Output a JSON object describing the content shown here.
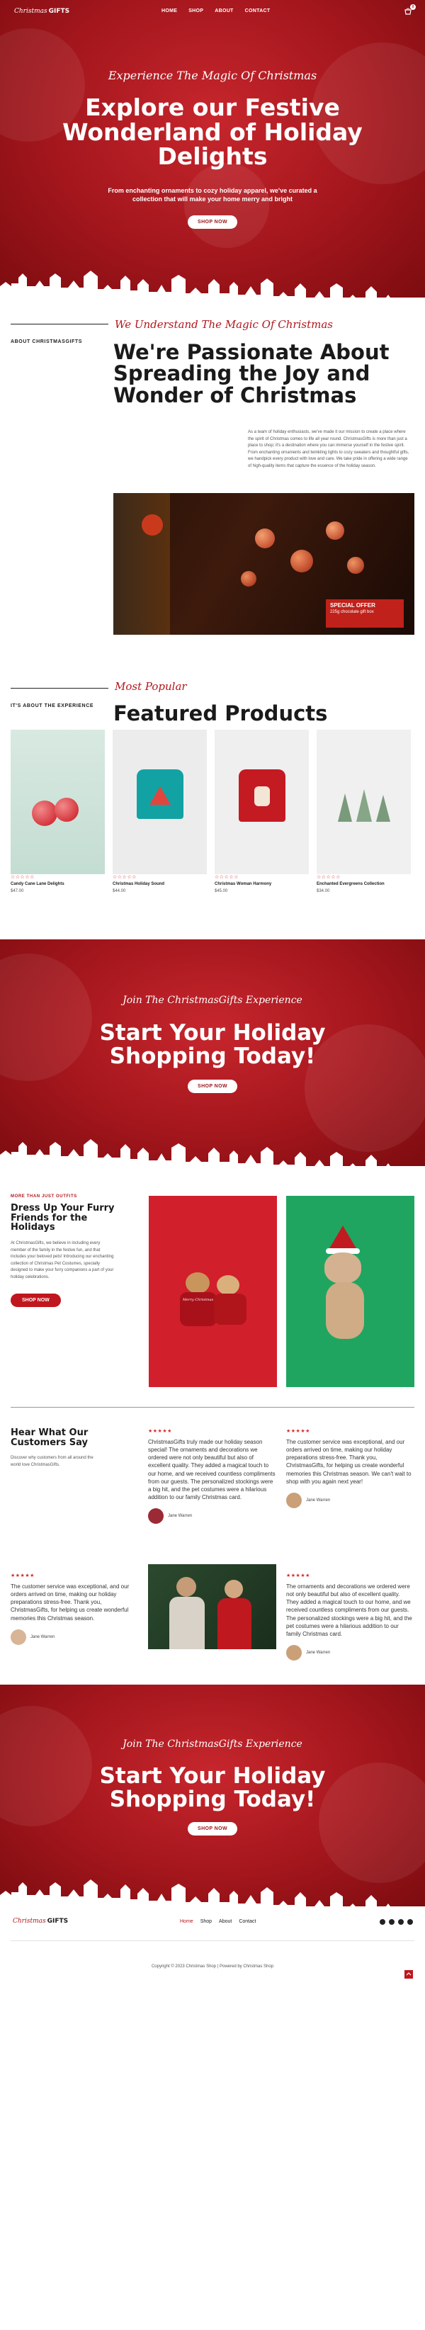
{
  "header": {
    "logo_script": "Christmas",
    "logo_bold": "GIFTS",
    "nav": [
      "HOME",
      "SHOP",
      "ABOUT",
      "CONTACT"
    ],
    "cart_count": "0"
  },
  "hero": {
    "kicker": "Experience The Magic Of Christmas",
    "title_line1": "Explore our Festive",
    "title_line2": "Wonderland of Holiday",
    "title_line3": "Delights",
    "subtitle_line1": "From enchanting ornaments to cozy holiday apparel, we've curated a",
    "subtitle_line2": "collection that will make your home merry and bright",
    "button": "SHOP NOW"
  },
  "about": {
    "label": "ABOUT CHRISTMASGIFTS",
    "kicker": "We Understand The Magic Of Christmas",
    "title_line1": "We're Passionate About",
    "title_line2": "Spreading the Joy and",
    "title_line3": "Wonder of Christmas",
    "body": "As a team of holiday enthusiasts, we've made it our mission to create a place where the spirit of Christmas comes to life all year round. ChristmasGifts is more than just a place to shop; it's a destination where you can immerse yourself in the festive spirit. From enchanting ornaments and twinkling lights to cozy sweaters and thoughtful gifts, we handpick every product with love and care. We take pride in offering a wide range of high-quality items that capture the essence of the holiday season.",
    "image_sign_1": "SPECIAL OFFER",
    "image_sign_2": "225g chocolate gift box"
  },
  "featured": {
    "label": "IT'S ABOUT THE EXPERIENCE",
    "kicker": "Most Popular",
    "title": "Featured Products",
    "products": [
      {
        "name": "Candy Cane Lane Delights",
        "price": "$47.00",
        "rating": "☆☆☆☆☆"
      },
      {
        "name": "Christmas Holiday Sound",
        "price": "$44.00",
        "rating": "☆☆☆☆☆"
      },
      {
        "name": "Christmas Woman Harmony",
        "price": "$45.00",
        "rating": "☆☆☆☆☆"
      },
      {
        "name": "Enchanted Evergreens Collection",
        "price": "$34.00",
        "rating": "☆☆☆☆☆"
      }
    ]
  },
  "cta1": {
    "kicker": "Join The ChristmasGifts Experience",
    "title_line1": "Start Your Holiday",
    "title_line2": "Shopping Today!",
    "button": "SHOP NOW"
  },
  "pets": {
    "label": "MORE THAN JUST OUTFITS",
    "title_line1": "Dress Up Your Furry",
    "title_line2": "Friends for the",
    "title_line3": "Holidays",
    "body": "At ChristmasGifts, we believe in including every member of the family in the festive fun, and that includes your beloved pets! Introducing our enchanting collection of Christmas Pet Costumes, specially designed to make your furry companions a part of your holiday celebrations.",
    "button": "SHOP NOW",
    "sweater_text": "Merry Christmas"
  },
  "testimonials": {
    "title_line1": "Hear What Our",
    "title_line2": "Customers Say",
    "subtitle": "Discover why customers from all around the world love ChristmasGifts.",
    "reviews": [
      {
        "stars": "★★★★★",
        "text": "ChristmasGifts truly made our holiday season special! The ornaments and decorations we ordered were not only beautiful but also of excellent quality. They added a magical touch to our home, and we received countless compliments from our guests. The personalized stockings were a big hit, and the pet costumes were a hilarious addition to our family Christmas card.",
        "author": "Jane Warren"
      },
      {
        "stars": "★★★★★",
        "text": "The customer service was exceptional, and our orders arrived on time, making our holiday preparations stress-free. Thank you, ChristmasGifts, for helping us create wonderful memories this Christmas season. We can't wait to shop with you again next year!",
        "author": "Jane Warren"
      },
      {
        "stars": "★★★★★",
        "text": "The customer service was exceptional, and our orders arrived on time, making our holiday preparations stress-free. Thank you, ChristmasGifts, for helping us create wonderful memories this Christmas season.",
        "author": "Jane Warren"
      },
      {
        "stars": "★★★★★",
        "text": "The ornaments and decorations we ordered were not only beautiful but also of excellent quality. They added a magical touch to our home, and we received countless compliments from our guests. The personalized stockings were a big hit, and the pet costumes were a hilarious addition to our family Christmas card.",
        "author": "Jane Warren"
      }
    ]
  },
  "cta2": {
    "kicker": "Join The ChristmasGifts Experience",
    "title_line1": "Start Your Holiday",
    "title_line2": "Shopping Today!",
    "button": "SHOP NOW"
  },
  "footer": {
    "logo_script": "Christmas",
    "logo_bold": "GIFTS",
    "nav": [
      "Home",
      "Shop",
      "About",
      "Contact"
    ],
    "copyright": "Copyright © 2023 Christmas Shop | Powered by Christmas Shop"
  },
  "colors": {
    "brand_red": "#b3161c",
    "dark": "#1a1a1a",
    "star": "#d32b2b"
  },
  "icons": [
    "cart-icon",
    "facebook-icon",
    "instagram-icon",
    "twitter-icon",
    "youtube-icon",
    "scroll-top-icon"
  ]
}
